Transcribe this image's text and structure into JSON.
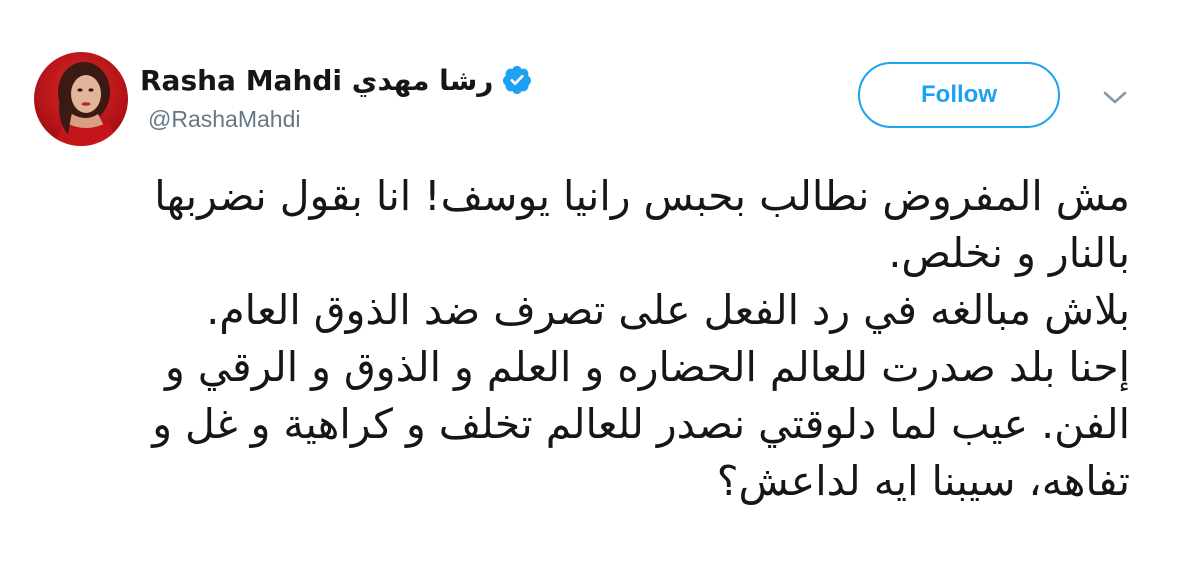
{
  "tweet": {
    "user": {
      "display_name": "رشا مهدي Rasha Mahdi",
      "handle": "@RashaMahdi",
      "verified": true,
      "avatar_icon": "profile-photo"
    },
    "follow_label": "Follow",
    "more_icon": "chevron-down-icon",
    "colors": {
      "accent": "#1da1f2",
      "text": "#14171a",
      "secondary_text": "#657786"
    },
    "lines": [
      "مش المفروض نطالب بحبس رانيا يوسف! انا بقول نضربها",
      "بالنار و نخلص.",
      "بلاش مبالغه في رد الفعل على تصرف ضد الذوق العام.",
      "إحنا بلد صدرت للعالم الحضاره و العلم و الذوق و الرقي و",
      "الفن. عيب لما دلوقتي نصدر للعالم تخلف و كراهية و غل و",
      "تفاهه، سيبنا ايه لداعش؟"
    ]
  }
}
